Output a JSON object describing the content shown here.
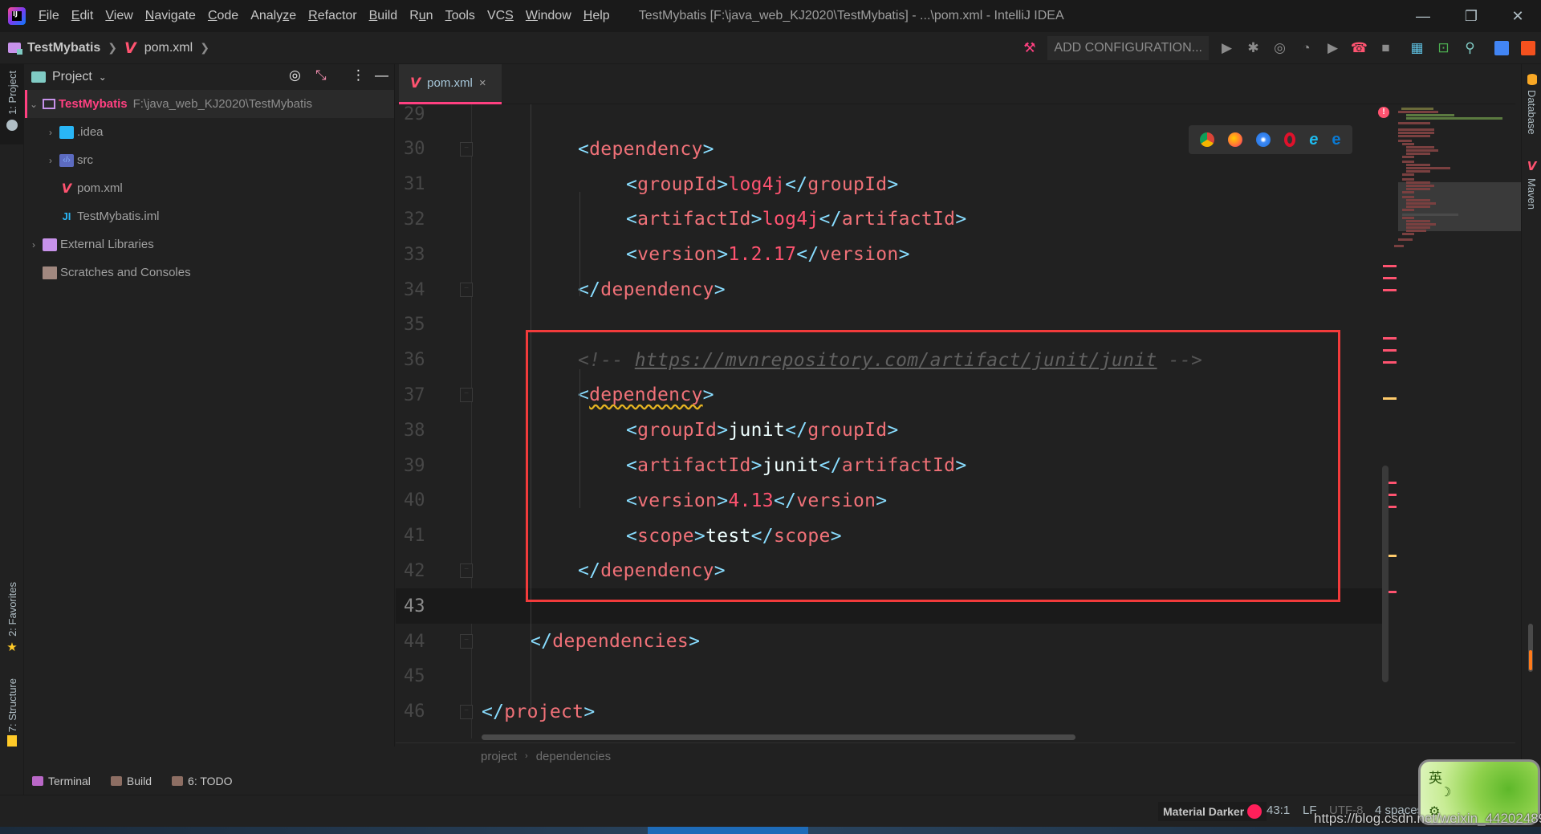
{
  "window": {
    "title": "TestMybatis [F:\\java_web_KJ2020\\TestMybatis] - ...\\pom.xml - IntelliJ IDEA",
    "controls": {
      "minimize": "—",
      "restore": "❐",
      "close": "✕"
    }
  },
  "menu": [
    {
      "label": "File",
      "mnemonic_index": 0
    },
    {
      "label": "Edit",
      "mnemonic_index": 0
    },
    {
      "label": "View",
      "mnemonic_index": 0
    },
    {
      "label": "Navigate",
      "mnemonic_index": 0
    },
    {
      "label": "Code",
      "mnemonic_index": 0
    },
    {
      "label": "Analyze",
      "mnemonic_index": 5
    },
    {
      "label": "Refactor",
      "mnemonic_index": 0
    },
    {
      "label": "Build",
      "mnemonic_index": 0
    },
    {
      "label": "Run",
      "mnemonic_index": 1
    },
    {
      "label": "Tools",
      "mnemonic_index": 0
    },
    {
      "label": "VCS",
      "mnemonic_index": 2
    },
    {
      "label": "Window",
      "mnemonic_index": 0
    },
    {
      "label": "Help",
      "mnemonic_index": 0
    }
  ],
  "navbar": {
    "project": "TestMybatis",
    "file": "pom.xml",
    "run_config": "ADD CONFIGURATION...",
    "toolbar_icons": [
      "hammer-icon",
      "run-icon",
      "debug-icon",
      "run-coverage-icon",
      "profiler-icon",
      "run-secondary-icon",
      "attach-debugger-icon",
      "stop-icon",
      "project-structure-icon",
      "terminal-icon",
      "search-everywhere-icon",
      "translate-icon",
      "google-translate-icon"
    ]
  },
  "left_strip": {
    "project_tab": "1: Project",
    "favorites_tab": "2: Favorites",
    "structure_tab": "7: Structure"
  },
  "project_panel": {
    "title": "Project",
    "root": {
      "name": "TestMybatis",
      "path": "F:\\java_web_KJ2020\\TestMybatis"
    },
    "items": [
      {
        "name": ".idea",
        "icon": "idea-folder-icon",
        "expandable": true
      },
      {
        "name": "src",
        "icon": "source-folder-icon",
        "expandable": true
      },
      {
        "name": "pom.xml",
        "icon": "maven-icon",
        "expandable": false
      },
      {
        "name": "TestMybatis.iml",
        "icon": "iml-file-icon",
        "expandable": false
      }
    ],
    "external_libraries": "External Libraries",
    "scratches": "Scratches and Consoles"
  },
  "editor": {
    "tab": {
      "label": "pom.xml",
      "close": "×"
    },
    "current_line": 43,
    "lines": [
      {
        "n": "29"
      },
      {
        "n": "30"
      },
      {
        "n": "31"
      },
      {
        "n": "32"
      },
      {
        "n": "33"
      },
      {
        "n": "34"
      },
      {
        "n": "35"
      },
      {
        "n": "36"
      },
      {
        "n": "37"
      },
      {
        "n": "38"
      },
      {
        "n": "39"
      },
      {
        "n": "40"
      },
      {
        "n": "41"
      },
      {
        "n": "42"
      },
      {
        "n": "43"
      },
      {
        "n": "44"
      },
      {
        "n": "45"
      },
      {
        "n": "46"
      }
    ],
    "code": {
      "dep_tag": "dependency",
      "deps_tag": "dependencies",
      "project_tag": "project",
      "group_tag": "groupId",
      "artifact_tag": "artifactId",
      "version_tag": "version",
      "scope_tag": "scope",
      "log4j_group": "log4j",
      "log4j_artifact": "log4j",
      "log4j_version": "1.2.17",
      "comment_open": "<!-- ",
      "comment_url": "https://mvnrepository.com/artifact/junit/junit",
      "comment_close": " -->",
      "junit_group": "junit",
      "junit_artifact": "junit",
      "junit_version": "4.13",
      "junit_scope": "test"
    },
    "breadcrumb": [
      "project",
      "dependencies"
    ]
  },
  "right_strip": {
    "database_tab": "Database",
    "maven_tab": "Maven"
  },
  "bottom_tools": [
    {
      "label": "Terminal",
      "icon": "terminal-icon"
    },
    {
      "label": "Build",
      "icon": "build-icon"
    },
    {
      "label": "6: TODO",
      "icon": "todo-icon"
    }
  ],
  "status": {
    "theme": "Material Darker",
    "position": "43:1",
    "line_separator": "LF",
    "encoding": "UTF-8",
    "indent": "4 spaces"
  },
  "overlay": {
    "ime_char": "英",
    "watermark": "https://blog.csdn.net/weixin_44202489"
  },
  "colors": {
    "accent": "#ff4081",
    "highlight_box": "#f23b3b",
    "tag_bracket": "#89ddff",
    "tag_name": "#f07178",
    "value": "#ff5370"
  }
}
